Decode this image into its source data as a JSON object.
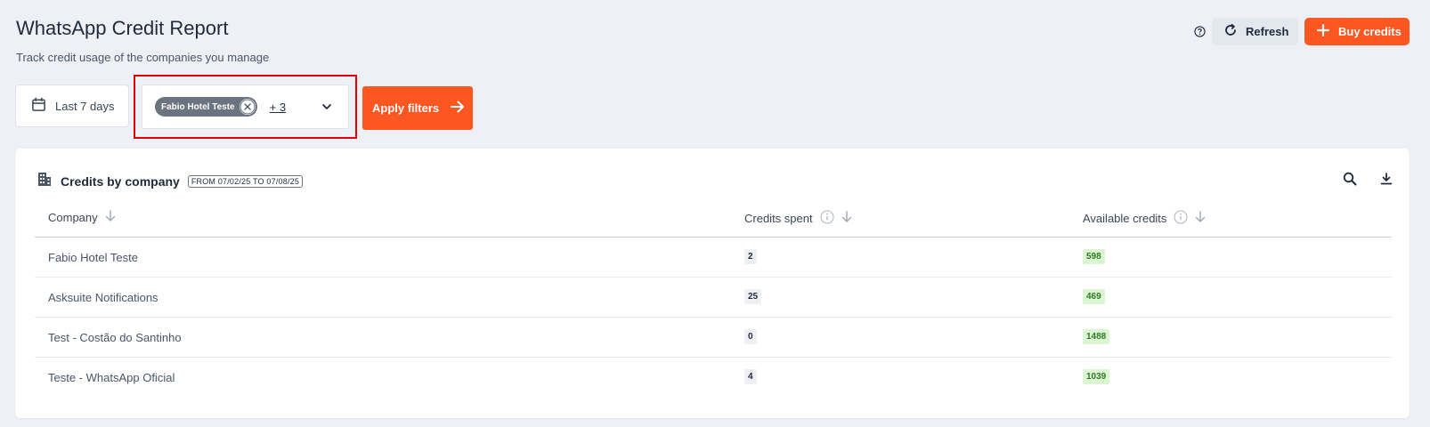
{
  "header": {
    "title": "WhatsApp Credit Report",
    "subtitle": "Track credit usage of the companies you manage",
    "refresh_label": "Refresh",
    "buy_label": "Buy credits"
  },
  "filters": {
    "date_label": "Last 7 days",
    "selected_company": "Fabio Hotel Teste",
    "more_count": "+ 3",
    "apply_label": "Apply filters"
  },
  "card": {
    "title": "Credits by company",
    "date_range": "FROM 07/02/25 TO 07/08/25",
    "columns": {
      "company": "Company",
      "spent": "Credits spent",
      "available": "Available credits"
    },
    "rows": [
      {
        "company": "Fabio Hotel Teste",
        "spent": "2",
        "available": "598"
      },
      {
        "company": "Asksuite Notifications",
        "spent": "25",
        "available": "469"
      },
      {
        "company": "Test - Costão do Santinho",
        "spent": "0",
        "available": "1488"
      },
      {
        "company": "Teste - WhatsApp Oficial",
        "spent": "4",
        "available": "1039"
      }
    ]
  },
  "colors": {
    "accent": "#fd5721",
    "highlight": "#e00000",
    "available_badge_bg": "#dcf5d3",
    "available_badge_text": "#2f7a24"
  },
  "icons": [
    "help-icon",
    "refresh-icon",
    "plus-icon",
    "calendar-icon",
    "close-icon",
    "chevron-down-icon",
    "arrow-right-icon",
    "building-icon",
    "info-icon",
    "sort-arrow-icon",
    "search-icon",
    "download-icon"
  ]
}
